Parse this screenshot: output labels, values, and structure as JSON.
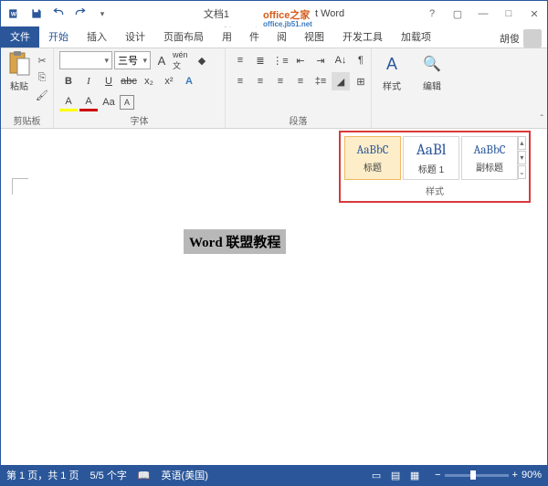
{
  "title": {
    "doc": "文档1",
    "app": "t Word"
  },
  "watermark": {
    "main": "office之家",
    "sub": "office.jb51.net"
  },
  "qat": {
    "word_icon": "W",
    "save": "save",
    "undo": "undo",
    "redo": "redo"
  },
  "wincontrols": {
    "help": "?",
    "opts": "▢",
    "min": "—",
    "max": "□",
    "close": "✕"
  },
  "tabs": {
    "file": "文件",
    "home": "开始",
    "insert": "插入",
    "design": "设计",
    "layout": "页面布局",
    "ref": "引用",
    "mail": "邮件",
    "review": "审阅",
    "view": "视图",
    "dev": "开发工具",
    "addins": "加载项",
    "user": "胡俊"
  },
  "ribbon": {
    "clipboard": {
      "label": "剪贴板",
      "paste": "粘贴"
    },
    "font": {
      "label": "字体",
      "family": "",
      "size": "三号",
      "b": "B",
      "i": "I",
      "u": "U",
      "strike": "abc",
      "sub": "x₂",
      "sup": "x²",
      "wen": "wén文",
      "aa": "A",
      "clear": "◆",
      "color_a": "A",
      "hl_a": "A",
      "grow": "A",
      "shrink": "A",
      "case": "Aa"
    },
    "para": {
      "label": "段落"
    },
    "styles": {
      "label": "样式",
      "btn": "样式"
    },
    "editing": {
      "btn": "编辑"
    }
  },
  "gallery": {
    "label": "样式",
    "items": [
      {
        "preview": "AaBbC",
        "name": "标题",
        "size": "13px",
        "sel": true
      },
      {
        "preview": "AaBl",
        "name": "标题 1",
        "size": "17px",
        "sel": false
      },
      {
        "preview": "AaBbC",
        "name": "副标题",
        "size": "13px",
        "sel": false
      }
    ],
    "up": "▴",
    "down": "▾",
    "more": "⌄"
  },
  "document": {
    "text": "Word 联盟教程"
  },
  "status": {
    "page": "第 1 页，共 1 页",
    "words": "5/5 个字",
    "lang": "英语(美国)",
    "zoom": "90%",
    "minus": "−",
    "plus": "+"
  }
}
